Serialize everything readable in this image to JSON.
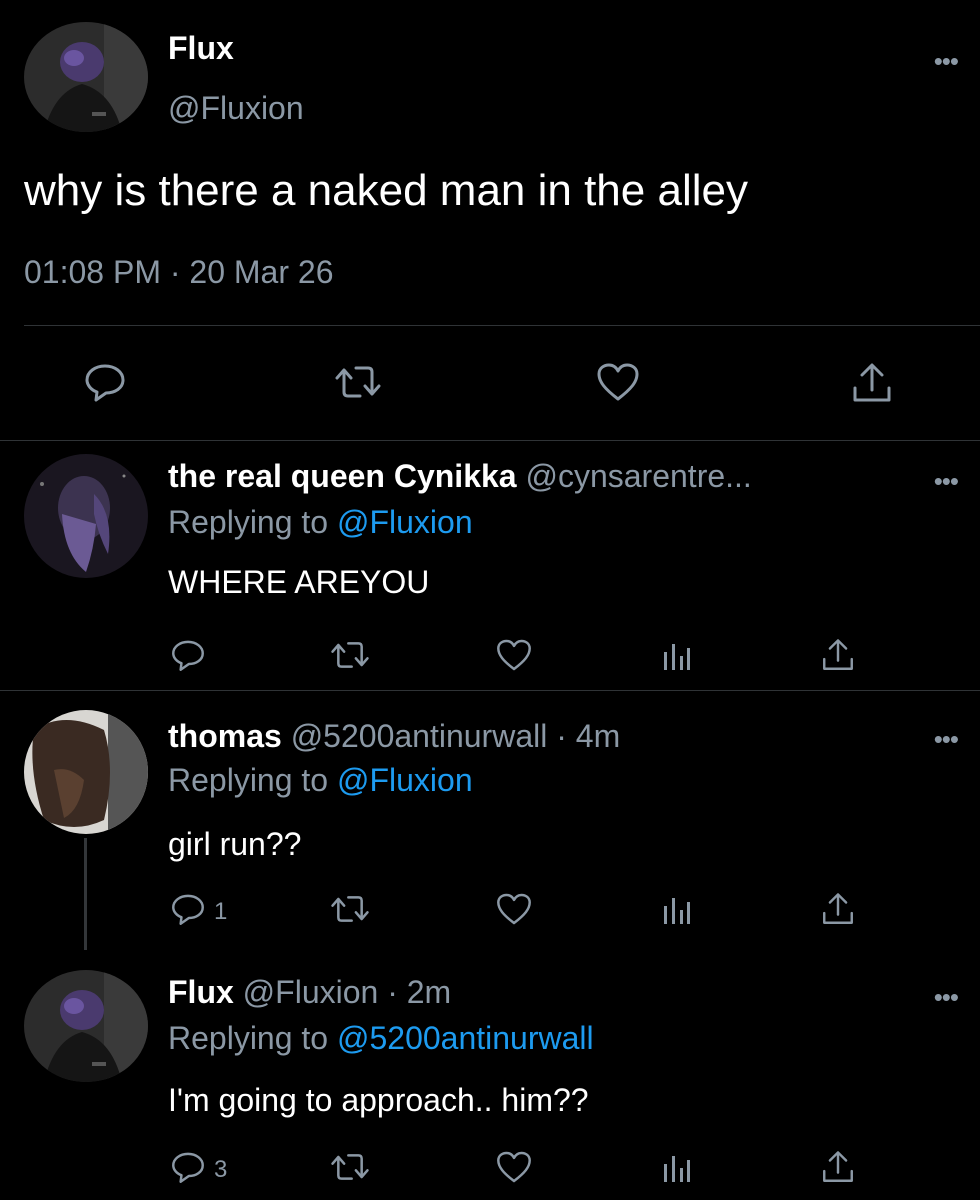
{
  "main_tweet": {
    "name": "Flux",
    "handle": "@Fluxion",
    "text": "why is there a naked man in the alley",
    "timestamp": "01:08 PM · 20 Mar 26",
    "more_icon": "more-horizontal-icon"
  },
  "replies": [
    {
      "name": "the real queen Cynikka",
      "handle": "@cynsarentre...",
      "time": "",
      "replying_label": "Replying to",
      "replying_to": "@Fluxion",
      "text": "WHERE AREYOU",
      "reply_count": ""
    },
    {
      "name": "thomas",
      "handle": "@5200antinurwall",
      "time": "· 4m",
      "replying_label": "Replying to",
      "replying_to": "@Fluxion",
      "text": "girl run??",
      "reply_count": "1"
    },
    {
      "name": "Flux",
      "handle": "@Fluxion",
      "time": "· 2m",
      "replying_label": "Replying to",
      "replying_to": "@5200antinurwall",
      "text": "I'm going to approach.. him??",
      "reply_count": "3"
    }
  ],
  "colors": {
    "background": "#000000",
    "text": "#ffffff",
    "secondary": "#8b98a5",
    "link": "#1d9bf0",
    "divider": "#2f3336"
  },
  "icons": [
    "reply-icon",
    "retweet-icon",
    "like-icon",
    "share-icon",
    "analytics-icon",
    "more-horizontal-icon"
  ]
}
